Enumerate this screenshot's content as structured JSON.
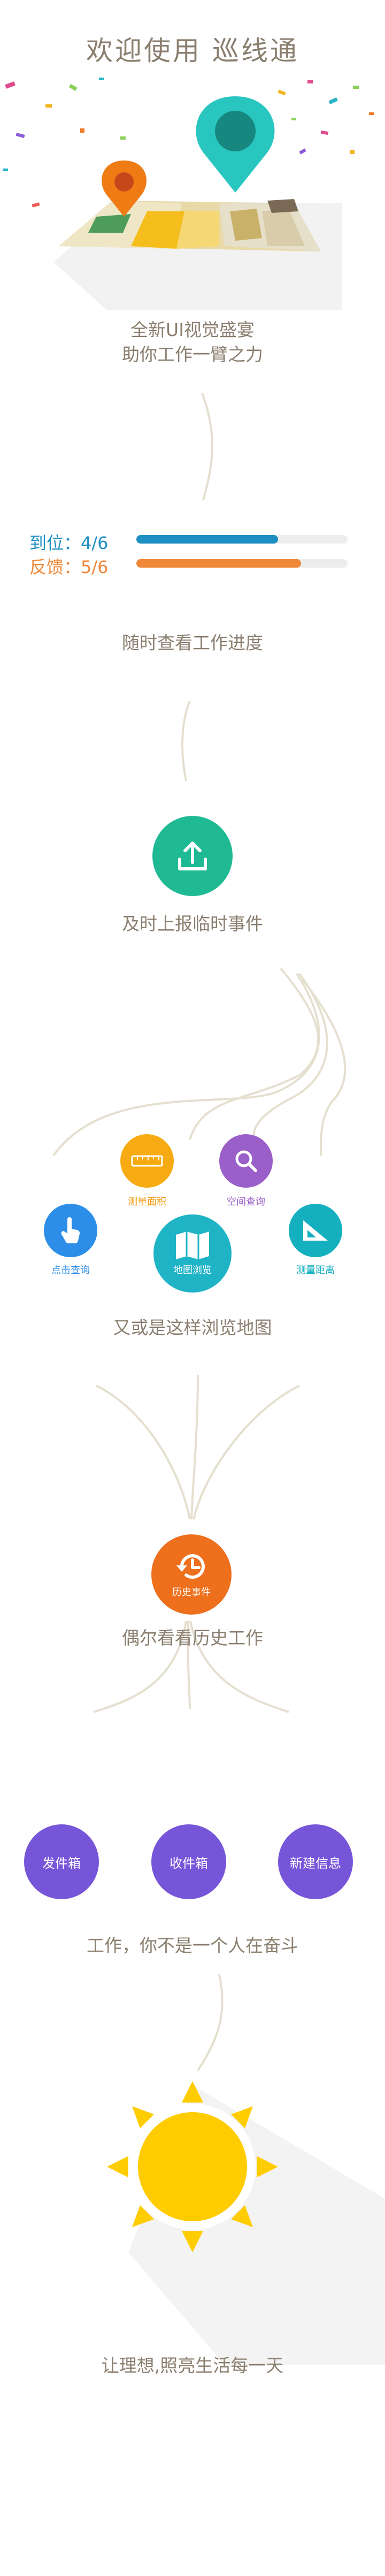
{
  "title": "欢迎使用 巡线通",
  "intro": {
    "line1": "全新UI视觉盛宴",
    "line2": "助你工作一臂之力"
  },
  "progress": {
    "items": [
      {
        "label": "到位：4/6",
        "value": 0.67,
        "color": "#1e8fc3"
      },
      {
        "label": "反馈：5/6",
        "value": 0.78,
        "color": "#f0883a"
      }
    ],
    "caption": "随时查看工作进度"
  },
  "upload": {
    "icon": "upload-icon",
    "caption": "及时上报临时事件",
    "color": "#1fba94"
  },
  "map_tools": {
    "measure_area": {
      "label": "测量面积",
      "icon": "ruler-icon",
      "color": "#f6ab12"
    },
    "space_query": {
      "label": "空间查询",
      "icon": "magnifier-icon",
      "color": "#9a5fc8"
    },
    "click_query": {
      "label": "点击查询",
      "icon": "pointer-hand-icon",
      "color": "#2c8ee8"
    },
    "map_browse": {
      "label": "地图浏览",
      "icon": "folded-map-icon",
      "color": "#1fb3c6"
    },
    "measure_distance": {
      "label": "测量距离",
      "icon": "set-square-icon",
      "color": "#14b0c0"
    },
    "caption": "又或是这样浏览地图"
  },
  "history": {
    "label": "历史事件",
    "icon": "history-clock-icon",
    "color": "#ee6f1c",
    "caption": "偶尔看看历史工作"
  },
  "mail": {
    "outbox": "发件箱",
    "inbox": "收件箱",
    "new_message": "新建信息",
    "color": "#7755d9",
    "caption": "工作，你不是一个人在奋斗"
  },
  "closing": {
    "caption": "让理想,照亮生活每一天",
    "sun_color": "#ffcc00"
  }
}
